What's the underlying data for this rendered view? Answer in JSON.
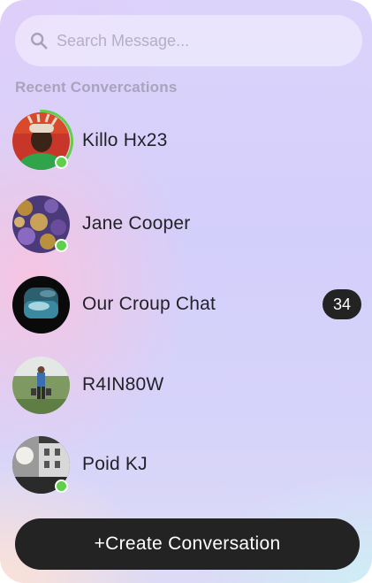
{
  "search": {
    "placeholder": "Search Message...",
    "icon": "search-icon"
  },
  "section_title": "Recent Convercations",
  "conversations": [
    {
      "name": "Killo Hx23",
      "online": true,
      "status_ring": true,
      "badge": ""
    },
    {
      "name": "Jane Cooper",
      "online": true,
      "status_ring": false,
      "badge": ""
    },
    {
      "name": "Our Croup Chat",
      "online": false,
      "status_ring": false,
      "badge": "34"
    },
    {
      "name": "R4IN80W",
      "online": false,
      "status_ring": false,
      "badge": ""
    },
    {
      "name": "Poid KJ",
      "online": true,
      "status_ring": false,
      "badge": ""
    }
  ],
  "create_button": {
    "label": "+Create Conversation"
  },
  "colors": {
    "online": "#5fd04a",
    "button_bg": "#232323",
    "badge_bg": "#232323",
    "text": "#232229",
    "muted": "#a9a3bc"
  }
}
